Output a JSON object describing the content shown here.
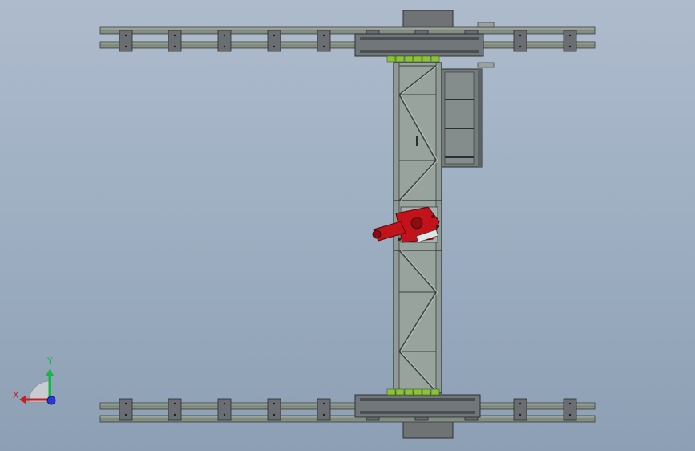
{
  "viewport": {
    "background_top": "#aebbcd",
    "background_bottom": "#8d9fb4"
  },
  "model": {
    "rail_color": "#8a9488",
    "bracket_color": "#6a6e72",
    "frame_color": "#8f9a94",
    "frame_dark": "#3a3f3f",
    "green_block_color": "#8cc23a",
    "robot_color": "#c2121b"
  },
  "triad": {
    "x_label": "X",
    "y_label": "Y",
    "x_color": "#d11a1a",
    "y_color": "#19b34a",
    "z_color": "#2a38d8"
  }
}
